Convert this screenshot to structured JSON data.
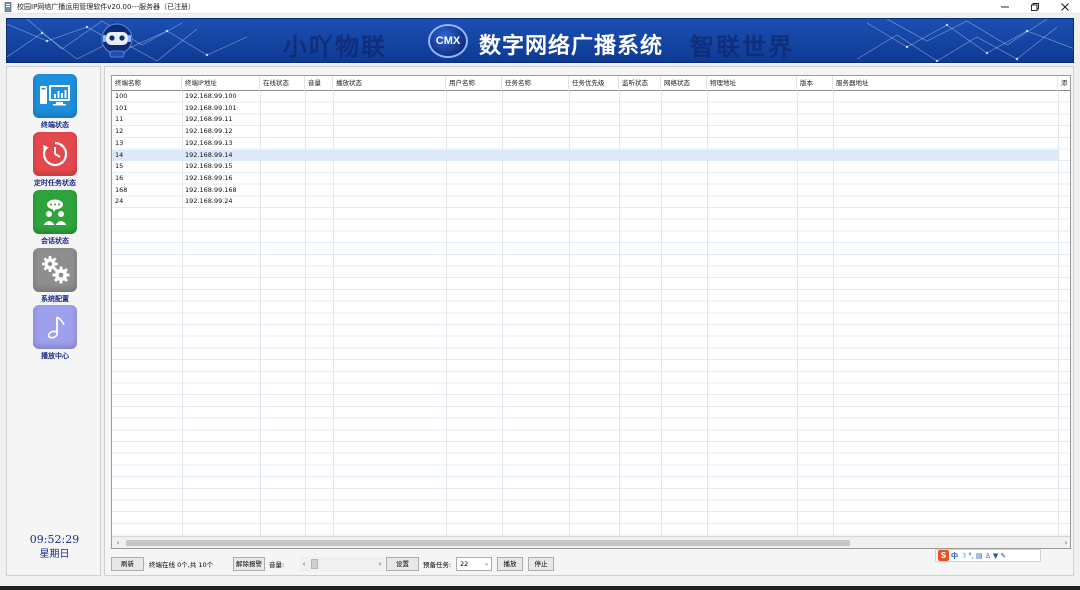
{
  "window": {
    "title": "校园IP网络广播运用管理软件v20.00---服务器（已注册）",
    "controls": [
      "minimize-icon",
      "restore-icon",
      "close-icon"
    ]
  },
  "banner": {
    "slogan_left": "小吖物联",
    "badge": "CMX",
    "title": "数字网络广播系统",
    "slogan_right": "智联世界"
  },
  "colors": {
    "banner_blue": "#1646a4",
    "nav_terminal": "#1e8fdc",
    "nav_task": "#e4484d",
    "nav_session": "#2ea33c",
    "nav_config": "#8e8e8e",
    "nav_play": "#9ea0ee",
    "selected_row": "#dbe9f8",
    "label_blue": "#1b2a8a"
  },
  "sidebar": {
    "items": [
      {
        "label": "终端状态",
        "icon": "monitor-chart-icon"
      },
      {
        "label": "定时任务状态",
        "icon": "clock-refresh-icon"
      },
      {
        "label": "会话状态",
        "icon": "chat-users-icon"
      },
      {
        "label": "系统配置",
        "icon": "gears-icon"
      },
      {
        "label": "播放中心",
        "icon": "music-note-icon"
      }
    ],
    "time": "09:52:29",
    "weekday": "星期日"
  },
  "grid": {
    "columns": [
      "终端名称",
      "终端IP地址",
      "在线状态",
      "音量",
      "播放状态",
      "用户名称",
      "任务名称",
      "任务优先级",
      "监听状态",
      "网络状态",
      "物理地址",
      "版本",
      "服务器地址",
      "添"
    ],
    "rows": [
      {
        "name": "100",
        "ip": "192.168.99.100"
      },
      {
        "name": "101",
        "ip": "192.168.99.101"
      },
      {
        "name": "11",
        "ip": "192.168.99.11"
      },
      {
        "name": "12",
        "ip": "192.168.99.12"
      },
      {
        "name": "13",
        "ip": "192.168.99.13"
      },
      {
        "name": "14",
        "ip": "192.168.99.14"
      },
      {
        "name": "15",
        "ip": "192.168.99.15"
      },
      {
        "name": "16",
        "ip": "192.168.99.16"
      },
      {
        "name": "168",
        "ip": "192.168.99.168"
      },
      {
        "name": "24",
        "ip": "192.168.99.24"
      }
    ],
    "selected_row_index": 5
  },
  "toolbar": {
    "refresh": "刷新",
    "status_text": "终端在线 0个,共 10个",
    "clear_alarm": "解除报警",
    "volume_label": "音量:",
    "settings": "设置",
    "preview_label": "预备任务:",
    "preview_value": "22",
    "play": "播放",
    "stop": "停止"
  },
  "ime": {
    "logo": "S",
    "mode": "中",
    "icons": [
      "moon-icon",
      "punctuation-icon",
      "keyboard-icon",
      "user-icon",
      "shirt-icon",
      "wrench-icon"
    ]
  }
}
